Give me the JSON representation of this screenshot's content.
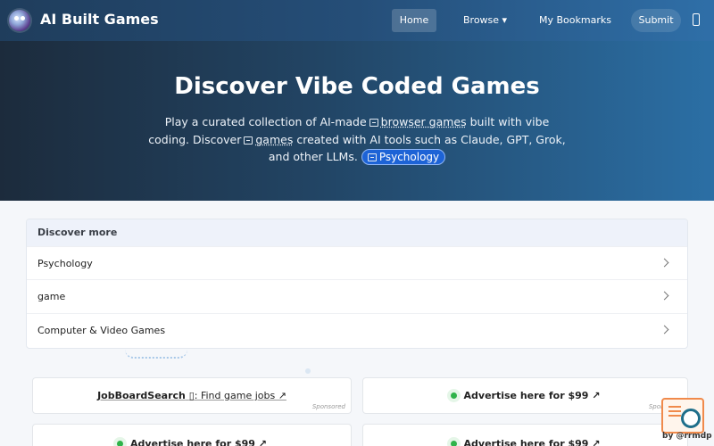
{
  "header": {
    "brand": "AI Built Games",
    "nav": {
      "home": "Home",
      "browse": "Browse ▾",
      "bookmarks": "My Bookmarks",
      "submit": "Submit"
    }
  },
  "hero": {
    "title": "Discover Vibe Coded Games",
    "desc_1": "Play a curated collection of AI-made",
    "link_1": "browser games",
    "desc_2": "built with vibe coding.",
    "desc_3": "Discover",
    "link_2": "games",
    "desc_4": "created with AI tools such as Claude, GPT, Grok, and other LLMs.",
    "chip": "Psychology"
  },
  "discover": {
    "heading": "Discover more",
    "items": [
      "Psychology",
      "game",
      "Computer & Video Games"
    ]
  },
  "cards": {
    "card1": {
      "title": "JobBoardSearch",
      "icon": "▯",
      "sub": ": Find game jobs ↗",
      "sponsored": "Sponsored"
    },
    "card2": {
      "title": "Advertise here for $99 ↗",
      "sponsored": "Sponsored"
    },
    "card3": {
      "title": "Advertise here for $99 ↗"
    },
    "card4": {
      "title": "Advertise here for $99 ↗"
    }
  },
  "widget": {
    "label": "by @rrmdp"
  },
  "colors": {
    "accent": "#1d63d6",
    "status_green": "#2fb34a",
    "widget_orange": "#f08a4b"
  }
}
